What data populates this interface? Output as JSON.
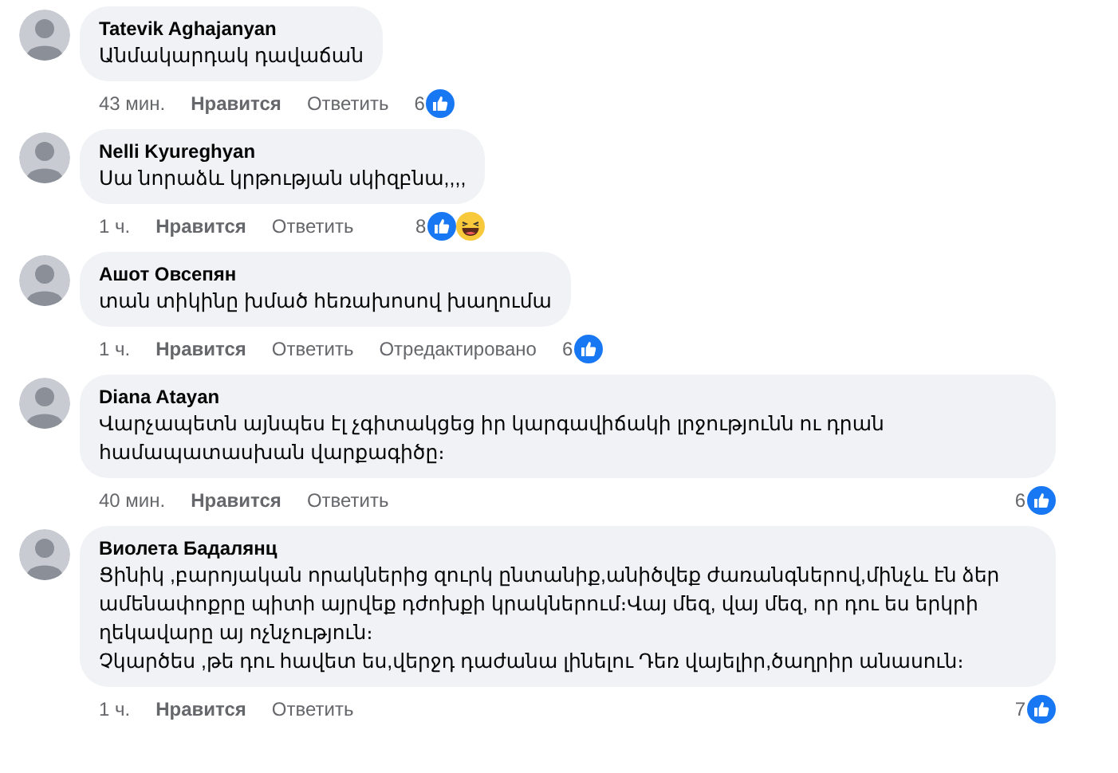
{
  "comments": [
    {
      "author": "Tatevik Aghajanyan",
      "text": "Անմակարդակ դավաճան",
      "time": "43 мин.",
      "like": "Нравится",
      "reply": "Ответить",
      "count": "6",
      "reactions": [
        {
          "kind": "like"
        }
      ]
    },
    {
      "author": "Nelli Kyureghyan",
      "text": "Սա նորաձև կրթության սկիզբնա,,,,",
      "time": "1 ч.",
      "like": "Нравится",
      "reply": "Ответить",
      "count": "8",
      "reactions": [
        {
          "kind": "like"
        },
        {
          "kind": "haha"
        }
      ]
    },
    {
      "author": "Ашот Овсепян",
      "text": "տան տիկինը խմած հեռախոսով խաղումա",
      "time": "1 ч.",
      "like": "Нравится",
      "reply": "Ответить",
      "edited": "Отредактировано",
      "count": "6",
      "reactions": [
        {
          "kind": "like"
        }
      ]
    },
    {
      "author": "Diana Atayan",
      "text": "Վարչապետն այնպես էլ չգիտակցեց իր կարգավիճակի լրջությունն ու դրան համապատասխան վարքագիծը։",
      "time": "40 мин.",
      "like": "Нравится",
      "reply": "Ответить",
      "count": "6",
      "reactions": [
        {
          "kind": "like"
        }
      ]
    },
    {
      "author": "Виолета Бадалянц",
      "text": "Ցինիկ ,բարոյական որակներից զուրկ ընտանիք,անիծվեք ժառանգներով,մինչև էն ձեր ամենափոքրը պիտի այրվեք դժոխքի կրակներում։Վայ մեզ, վայ մեզ, որ դու ես երկրի ղեկավարը այ ոչնչություն։\nՉկարծես ,թե դու հավետ ես,վերջդ դաժանա լինելու Դեռ վայելիր,ծաղրիր անասուն։",
      "time": "1 ч.",
      "like": "Нравится",
      "reply": "Ответить",
      "count": "7",
      "reactions": [
        {
          "kind": "like"
        }
      ]
    }
  ]
}
